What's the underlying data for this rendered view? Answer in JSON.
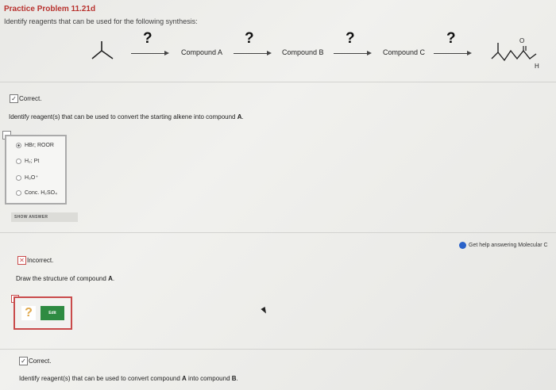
{
  "problem": {
    "title": "Practice Problem 11.21d",
    "instruction": "Identify reagents that can be used for the following synthesis:"
  },
  "scheme": {
    "qmark": "?",
    "compounds": [
      "Compound A",
      "Compound B",
      "Compound C"
    ],
    "product_labels": {
      "oxygen": "O",
      "hydrogen": "H"
    }
  },
  "q1": {
    "status": "Correct.",
    "question": "Identify reagent(s) that can be used to convert the starting alkene into compound",
    "target": "A",
    "options": [
      {
        "label": "HBr; ROOR",
        "selected": true
      },
      {
        "label": "H₂; Pt",
        "selected": false
      },
      {
        "label": "H₃O⁺",
        "selected": false
      },
      {
        "label": "Conc. H₂SO₄",
        "selected": false
      }
    ],
    "show_answer_label": "SHOW ANSWER"
  },
  "help": {
    "label": "Get help answering Molecular C"
  },
  "q2": {
    "status": "Incorrect.",
    "question": "Draw the structure of compound",
    "target": "A",
    "placeholder": "?",
    "edit_label": "Edit"
  },
  "q3": {
    "status": "Correct.",
    "question_pre": "Identify reagent(s) that can be used to convert compound",
    "from": "A",
    "question_mid": "into compound",
    "to": "B"
  },
  "colors": {
    "title_red": "#b8322e",
    "incorrect_red": "#c94b4b",
    "edit_green": "#2e8b42",
    "help_blue": "#2a62c9"
  }
}
